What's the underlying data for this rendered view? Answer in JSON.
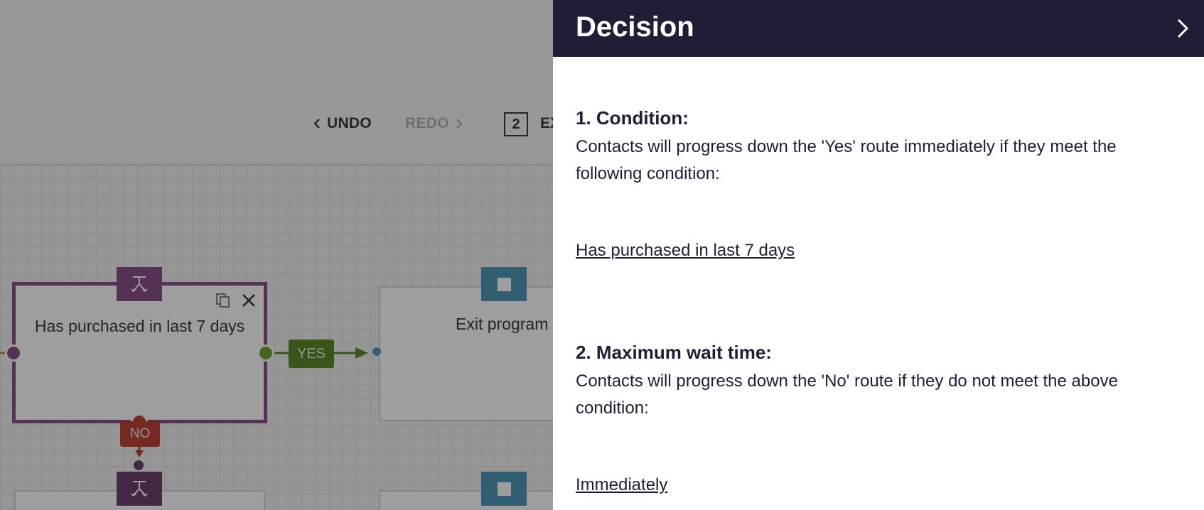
{
  "toolbar": {
    "undo_label": "UNDO",
    "redo_label": "REDO",
    "badge_count": "2",
    "partial_label": "EX"
  },
  "canvas": {
    "decision_node": {
      "title": "Has purchased in last 7 days"
    },
    "exit_node": {
      "title": "Exit program"
    },
    "yes_label": "YES",
    "no_label": "NO"
  },
  "panel": {
    "title": "Decision",
    "condition": {
      "heading": "1. Condition:",
      "text": "Contacts will progress down the 'Yes' route immediately if they meet the following condition:",
      "value": "Has purchased in last 7 days"
    },
    "wait": {
      "heading": "2. Maximum wait time:",
      "text": "Contacts will progress down the 'No' route if they do not meet the above condition:",
      "value": "Immediately"
    }
  },
  "colors": {
    "header_bg": "#221d36",
    "decision_purple": "#7a3a7a",
    "yes_green": "#4a7a10",
    "no_red": "#b72a1a",
    "exit_blue": "#3a8ab0"
  }
}
